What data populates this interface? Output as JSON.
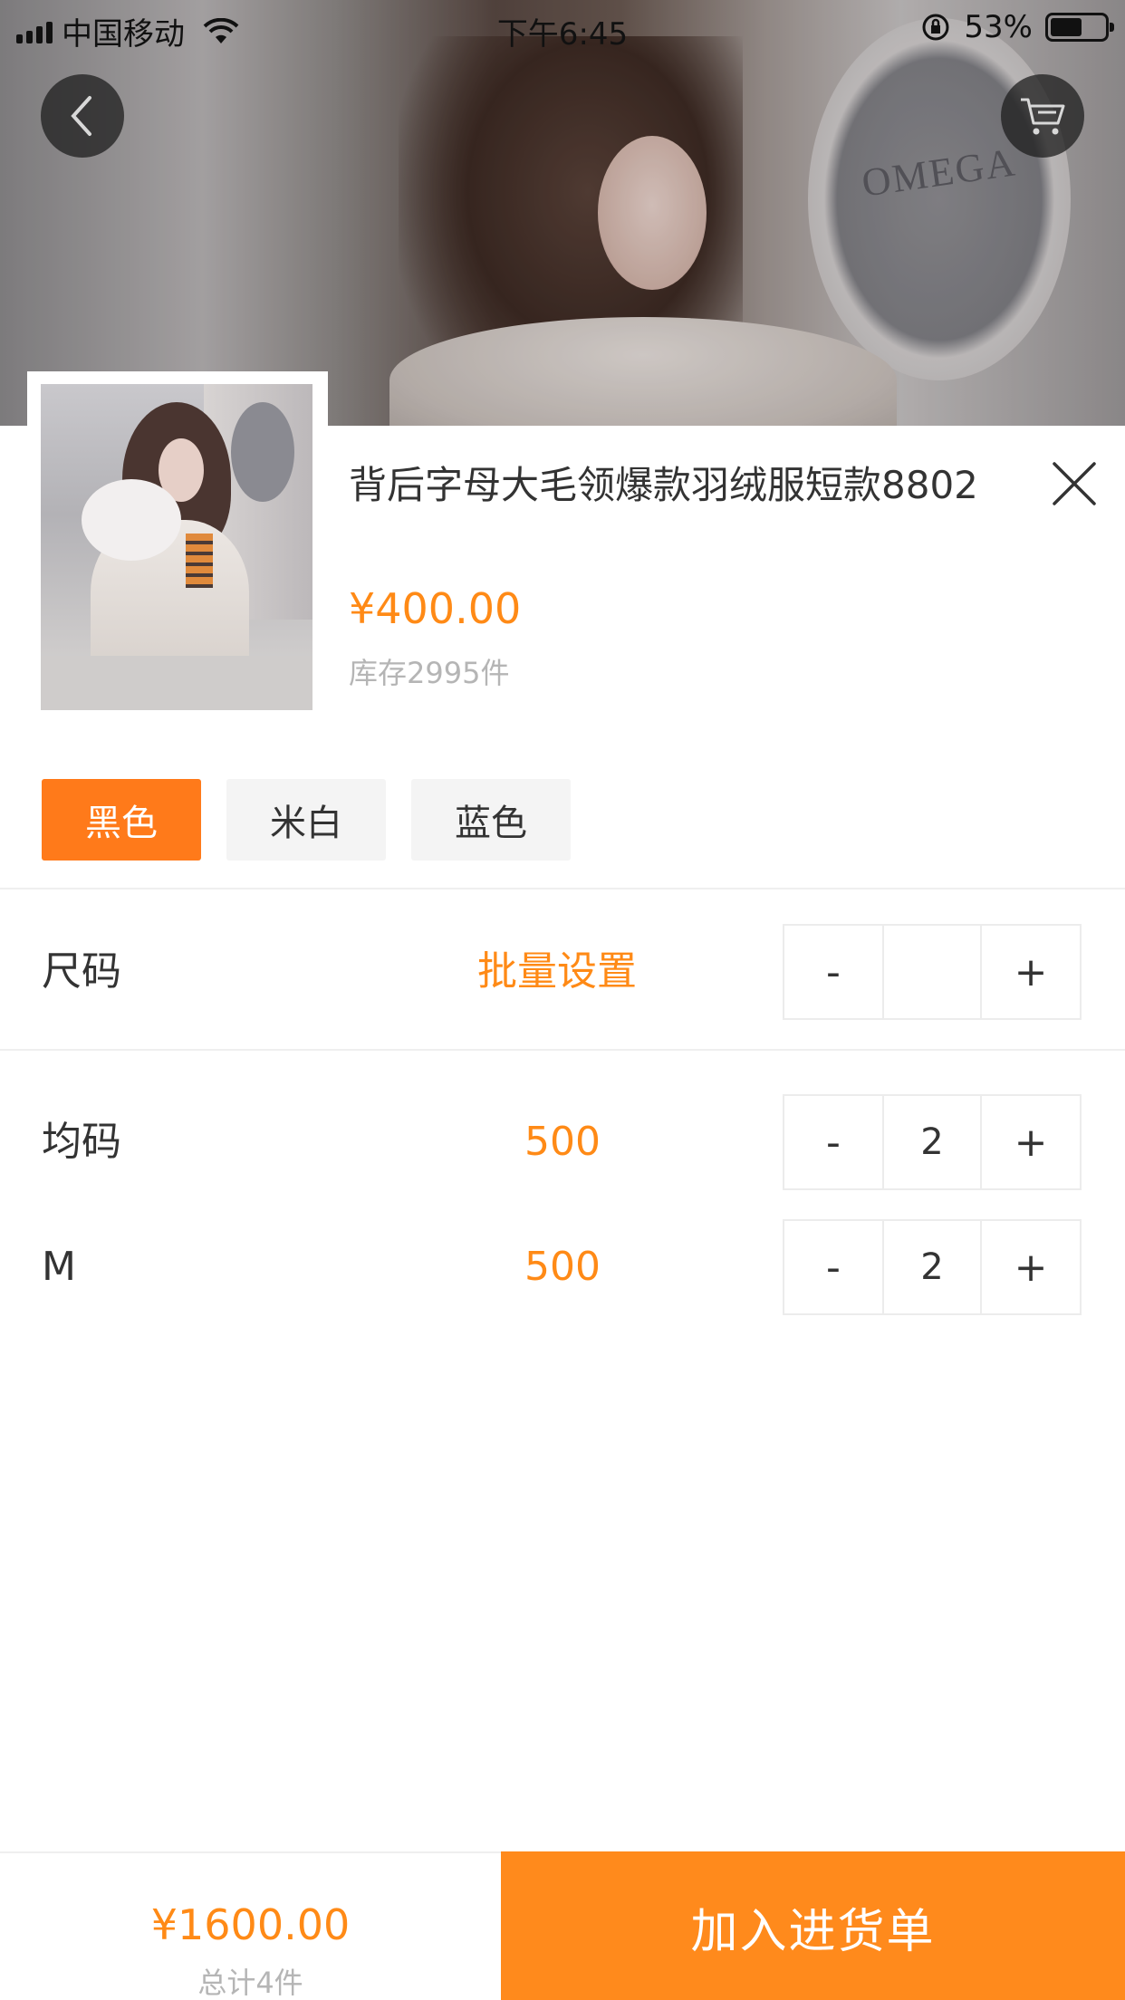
{
  "status_bar": {
    "carrier": "中国移动",
    "time": "下午6:45",
    "battery": "53%"
  },
  "product": {
    "title": "背后字母大毛领爆款羽绒服短款8802",
    "price": "¥400.00",
    "stock": "库存2995件",
    "hero_watermark": "OMEGA"
  },
  "colors": [
    {
      "label": "黑色",
      "selected": true
    },
    {
      "label": "米白",
      "selected": false
    },
    {
      "label": "蓝色",
      "selected": false
    }
  ],
  "size_header": {
    "label": "尺码",
    "batch": "批量设置",
    "minus": "-",
    "plus": "+",
    "value": ""
  },
  "sizes": [
    {
      "label": "均码",
      "stock": "500",
      "minus": "-",
      "quantity": "2",
      "plus": "+"
    },
    {
      "label": "M",
      "stock": "500",
      "minus": "-",
      "quantity": "2",
      "plus": "+"
    }
  ],
  "footer": {
    "total_price": "¥1600.00",
    "total_count": "总计4件",
    "add_button": "加入进货单"
  },
  "theme": {
    "accent": "#ff8a16",
    "button": "#ff8a1c",
    "chip_active": "#ff7a1a"
  },
  "icons": {
    "back": "chevron-left-icon",
    "cart": "cart-icon",
    "close": "close-icon"
  }
}
